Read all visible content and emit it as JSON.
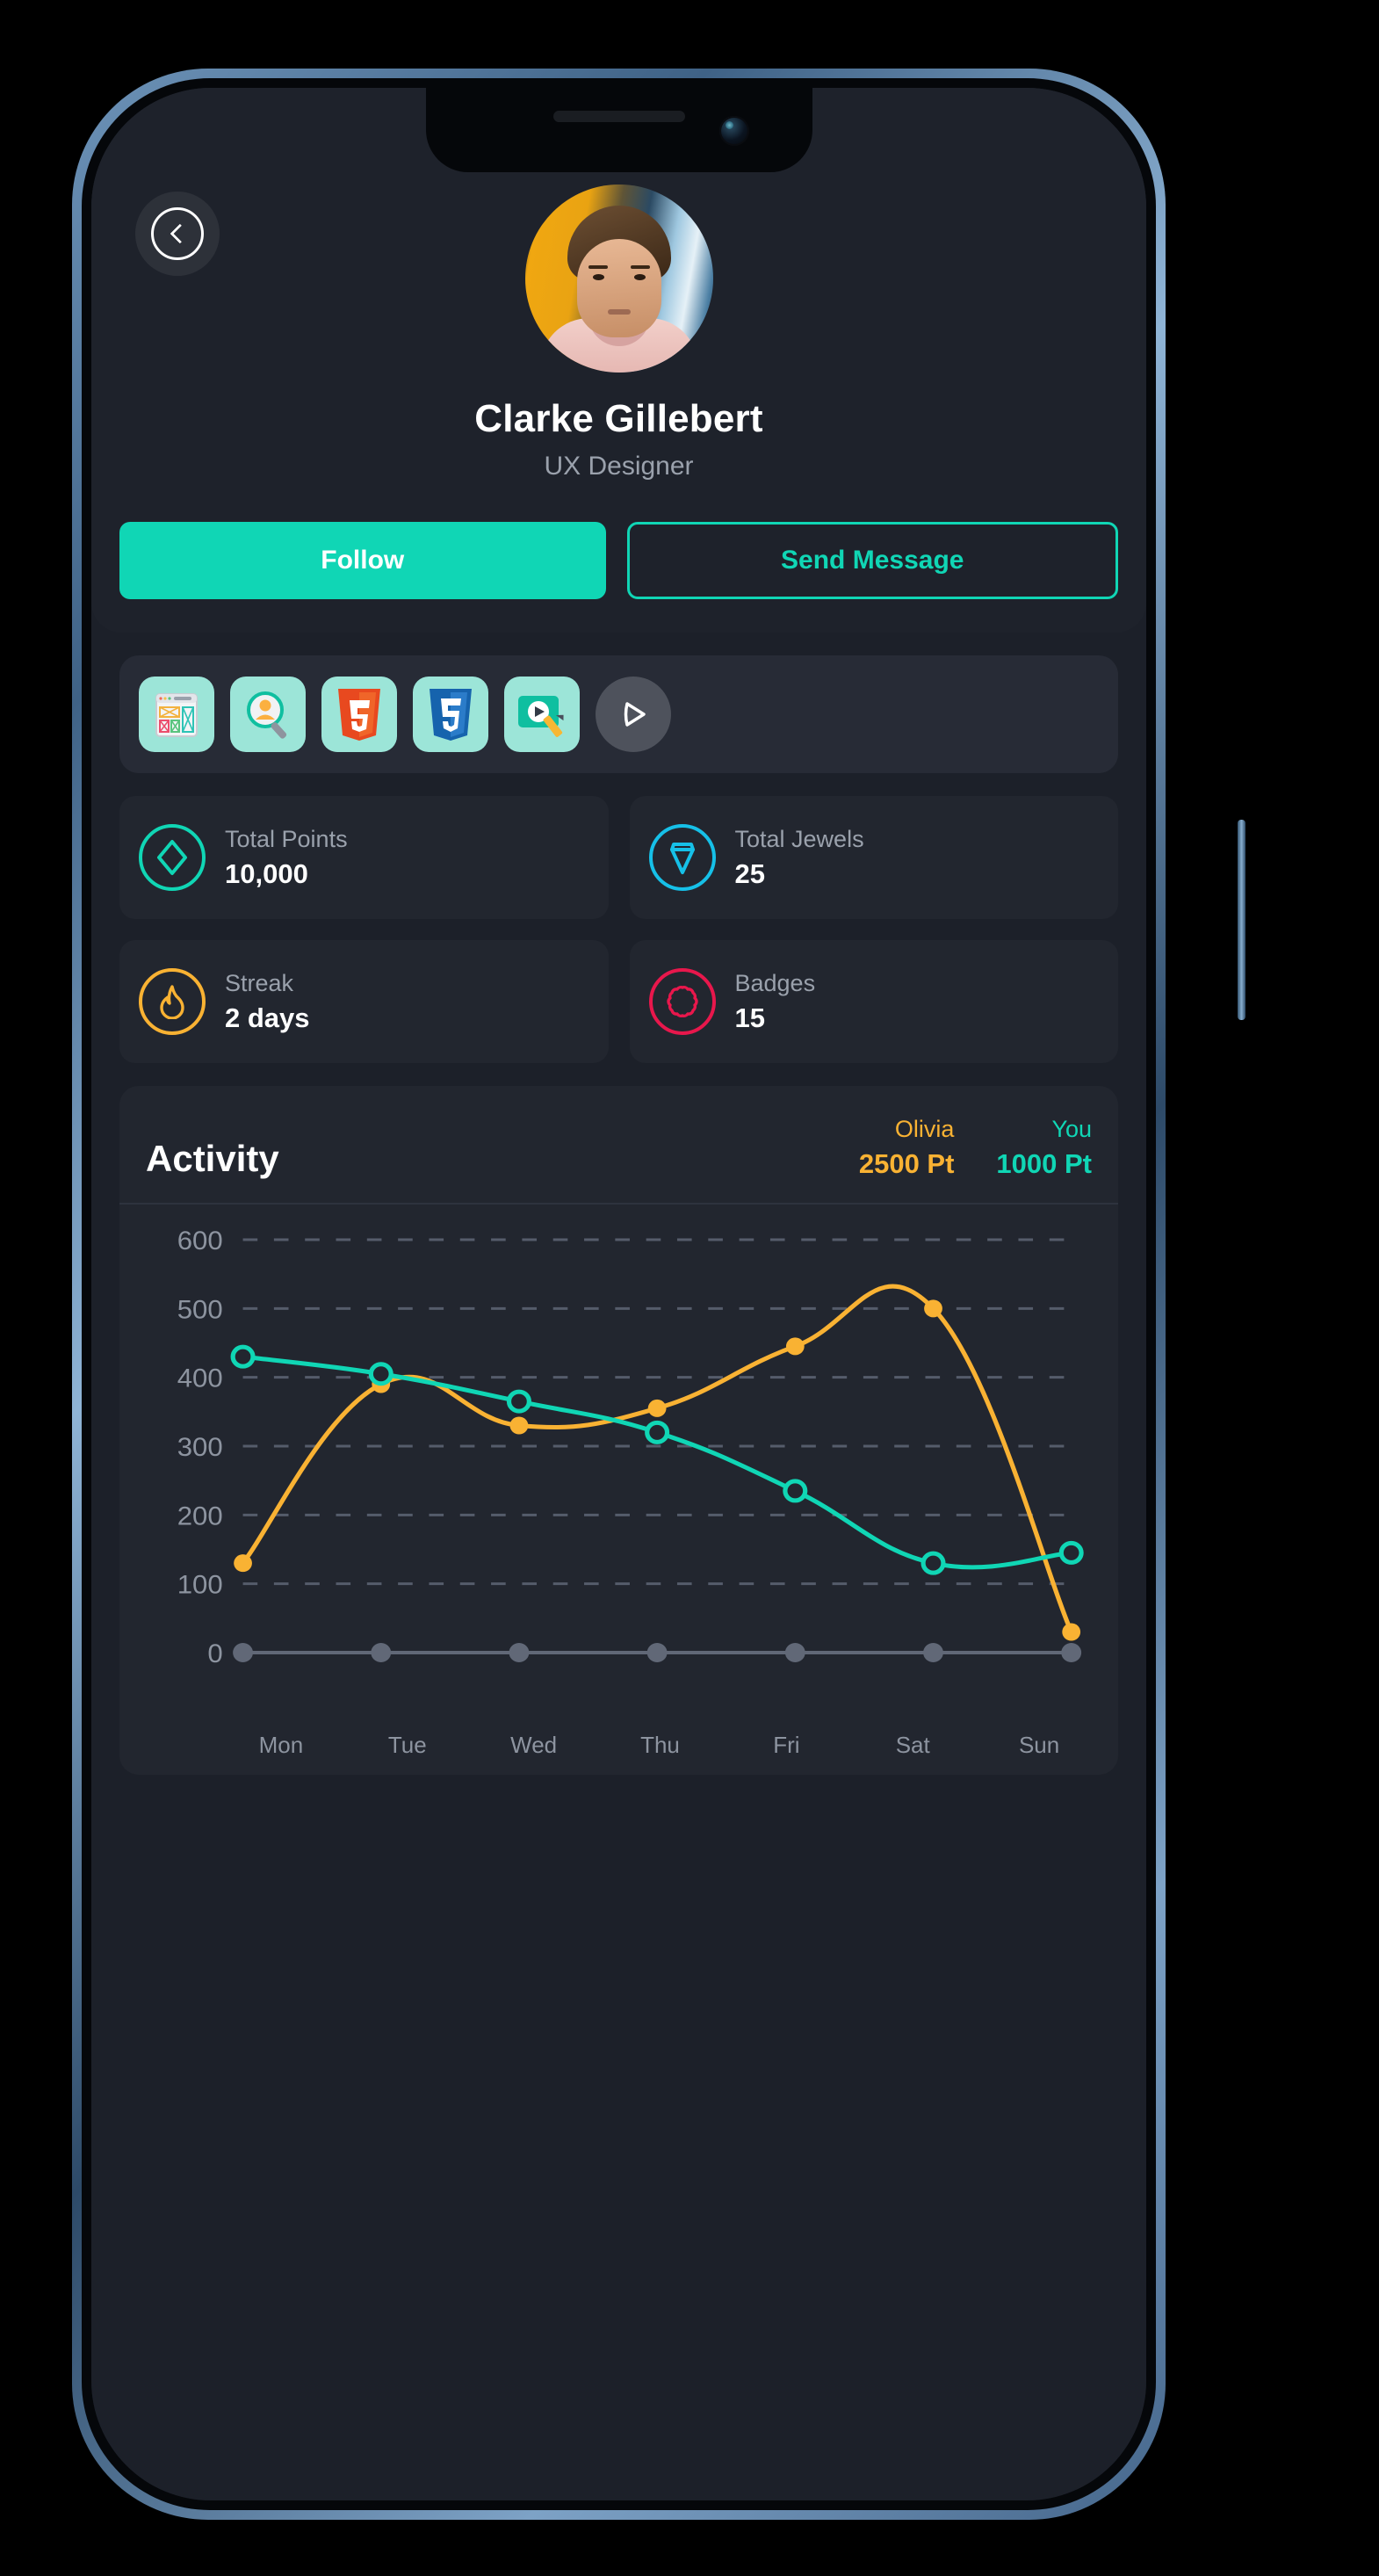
{
  "profile": {
    "back_icon": "chevron-left-icon",
    "name": "Clarke Gillebert",
    "role": "UX Designer",
    "avatar_alt": "profile-photo"
  },
  "actions": {
    "follow_label": "Follow",
    "message_label": "Send Message"
  },
  "badges": {
    "items": [
      {
        "name": "wireframe-badge",
        "icon": "wireframe-icon"
      },
      {
        "name": "user-research-badge",
        "icon": "magnifier-user-icon"
      },
      {
        "name": "html5-badge",
        "icon": "html5-icon",
        "label": "5"
      },
      {
        "name": "css3-badge",
        "icon": "css3-icon",
        "label": "3"
      },
      {
        "name": "video-editing-badge",
        "icon": "video-edit-icon"
      }
    ],
    "next_label": "next-badge-button",
    "next_icon": "play-arrow-icon"
  },
  "stats": [
    {
      "label": "Total  Points",
      "value": "10,000",
      "icon": "diamond-icon",
      "color": "#10d6b5"
    },
    {
      "label": "Total Jewels",
      "value": "25",
      "icon": "gem-icon",
      "color": "#16c0e8"
    },
    {
      "label": "Streak",
      "value": "2 days",
      "icon": "flame-icon",
      "color": "#f9b233"
    },
    {
      "label": "Badges",
      "value": "15",
      "icon": "rosette-icon",
      "color": "#e8174c"
    }
  ],
  "activity": {
    "title": "Activity",
    "legends": [
      {
        "name": "Olivia",
        "points": "2500 Pt",
        "color": "#f9b233"
      },
      {
        "name": "You",
        "points": "1000 Pt",
        "color": "#10d6b5"
      }
    ]
  },
  "chart_data": {
    "type": "line",
    "title": "Activity",
    "xlabel": "",
    "ylabel": "",
    "categories": [
      "Mon",
      "Tue",
      "Wed",
      "Thu",
      "Fri",
      "Sat",
      "Sun"
    ],
    "yticks": [
      0,
      100,
      200,
      300,
      400,
      500,
      600
    ],
    "ylim": [
      0,
      600
    ],
    "grid": true,
    "grid_style": "dashed-horizontal",
    "legend_position": "top-right",
    "series": [
      {
        "name": "Olivia",
        "color": "#f9b233",
        "marker": "filled-dot",
        "values": [
          130,
          390,
          330,
          355,
          445,
          500,
          30
        ]
      },
      {
        "name": "You",
        "color": "#10d6b5",
        "marker": "open-dot",
        "values": [
          430,
          405,
          365,
          320,
          235,
          130,
          145
        ]
      }
    ]
  }
}
